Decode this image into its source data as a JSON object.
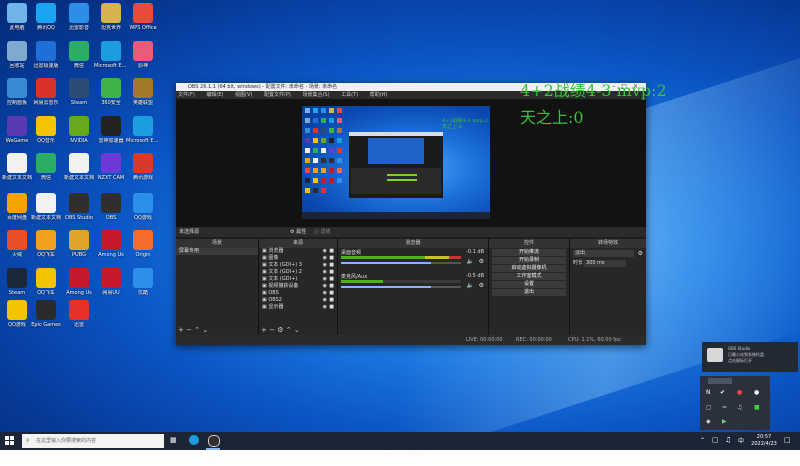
{
  "desktop": {
    "icons": [
      {
        "label": "此电脑",
        "color": "#6fb3e8"
      },
      {
        "label": "腾讯QQ",
        "color": "#1aa3f0"
      },
      {
        "label": "迅雷影音",
        "color": "#2d8ee8"
      },
      {
        "label": "坦克世界",
        "color": "#d8b24a"
      },
      {
        "label": "WPS Office",
        "color": "#e84b3a"
      },
      {
        "label": "回收站",
        "color": "#7fa9cf"
      },
      {
        "label": "迅雷极速版",
        "color": "#1e6fd8"
      },
      {
        "label": "微信",
        "color": "#2aae67"
      },
      {
        "label": "Microsoft Edge",
        "color": "#1b9de2"
      },
      {
        "label": "原神",
        "color": "#e65c7a"
      },
      {
        "label": "控制面板",
        "color": "#3a8ad8"
      },
      {
        "label": "网易云音乐",
        "color": "#d8322a"
      },
      {
        "label": "Steam",
        "color": "#2b4c75"
      },
      {
        "label": "360安全",
        "color": "#3fb24a"
      },
      {
        "label": "英雄联盟",
        "color": "#a2782b"
      },
      {
        "label": "WeGame",
        "color": "#5a3ab2"
      },
      {
        "label": "QQ音乐",
        "color": "#f5c300"
      },
      {
        "label": "NVIDIA",
        "color": "#67a91a"
      },
      {
        "label": "雷神加速器",
        "color": "#222222"
      },
      {
        "label": "Microsoft Edge",
        "color": "#1b9de2"
      },
      {
        "label": "新建文本文档",
        "color": "#f1f1f1"
      },
      {
        "label": "微信",
        "color": "#2aae67"
      },
      {
        "label": "新建文本文档",
        "color": "#f1f1f1"
      },
      {
        "label": "NZXT CAM",
        "color": "#6b3ad8"
      },
      {
        "label": "腾讯游戏",
        "color": "#d83a2a"
      },
      {
        "label": "百度网盘",
        "color": "#f5a300"
      },
      {
        "label": "新建文本文档",
        "color": "#f1f1f1"
      },
      {
        "label": "OBS Studio",
        "color": "#302e31"
      },
      {
        "label": "OBS",
        "color": "#302e31"
      },
      {
        "label": "QQ游戏",
        "color": "#2a90e8"
      },
      {
        "label": "火绒",
        "color": "#e8502a"
      },
      {
        "label": "QQ飞车",
        "color": "#f1a020"
      },
      {
        "label": "PUBG",
        "color": "#e0a526"
      },
      {
        "label": "Among Us",
        "color": "#c8192c"
      },
      {
        "label": "Origin",
        "color": "#f56c2d"
      },
      {
        "label": "Steam",
        "color": "#1b2838"
      },
      {
        "label": "QQ飞车",
        "color": "#f5c300"
      },
      {
        "label": "Among Us",
        "color": "#c8192c"
      },
      {
        "label": "网易UU",
        "color": "#c8192c"
      },
      {
        "label": "优酷",
        "color": "#2a90e8"
      },
      {
        "label": "QQ游戏",
        "color": "#f5c300"
      },
      {
        "label": "Epic Games",
        "color": "#2b2b2b"
      },
      {
        "label": "迅雷",
        "color": "#e8302a"
      }
    ]
  },
  "obs": {
    "title": "OBS 26.1.1 (64 bit, windows) - 配置文件: 未命名 - 场景: 未命名",
    "menu": [
      "文件(F)",
      "编辑(E)",
      "视图(V)",
      "配置文件(P)",
      "场景集合(S)",
      "工具(T)",
      "帮助(H)"
    ],
    "overlay_line1": "4+2战绩4-3 mvp:2",
    "overlay_line2": "天之上:0",
    "nested_overlay1": "4+2战绩4-3 mvp:2",
    "nested_overlay2": "天之上:0",
    "status_line": "未选择源",
    "props_label": "属性",
    "filters_label": "滤镜",
    "docks": {
      "scenes_title": "场景",
      "scene_items": [
        "屏幕专用"
      ],
      "sources_title": "来源",
      "source_items": [
        "浏览器",
        "图像",
        "文本 (GDI+) 3",
        "文本 (GDI+) 2",
        "文本 (GDI+)",
        "视频捕获设备",
        "OBS",
        "OBS2",
        "显示器"
      ],
      "mixer_title": "混音器",
      "mixer_tracks": [
        {
          "name": "桌面音频",
          "db": "-0.1 dB"
        },
        {
          "name": "麦克风/Aux",
          "db": "-0.5 dB"
        }
      ],
      "controls_title": "控件",
      "control_buttons": [
        "开始推流",
        "开始录制",
        "启动虚拟摄像机",
        "工作室模式",
        "设置",
        "退出"
      ],
      "transitions_title": "转场特效",
      "transition_value": "淡出",
      "duration_label": "时长",
      "duration_value": "300 ms"
    },
    "statusbar": {
      "live": "LIVE: 00:00:00",
      "rec": "REC: 00:00:00",
      "cpu": "CPU: 1.1%, 60.00 fps"
    }
  },
  "taskbar": {
    "search_placeholder": "在这里输入你要搜索的内容",
    "time": "20:57",
    "date": "2022/4/23"
  },
  "popup": {
    "line1": "OBS Studio",
    "line2": "已最小化到系统托盘",
    "line3": "点击图标打开"
  }
}
